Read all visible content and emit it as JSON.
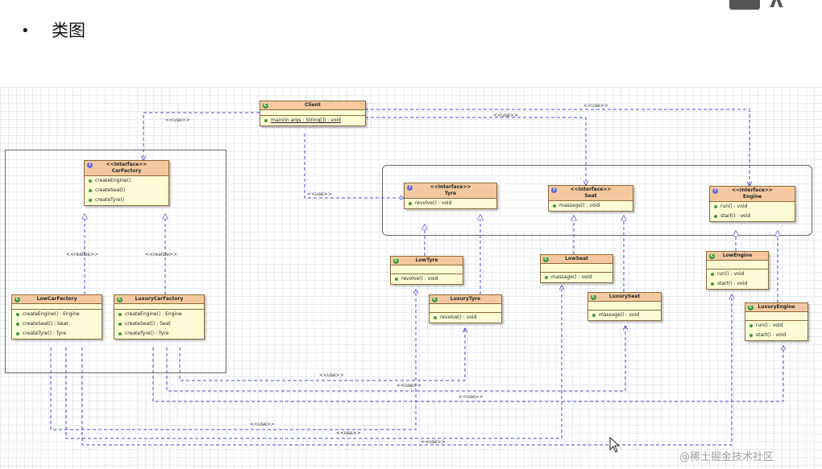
{
  "slide": {
    "bullet": "•",
    "heading": "类图"
  },
  "classes": {
    "client": {
      "name": "Client",
      "methods": [
        "main(in args : String[]) : void"
      ]
    },
    "car_factory": {
      "stereotype": "<<Interface>>",
      "name": "CarFactory",
      "methods": [
        "createEngine()",
        "createSeat()",
        "createTyre()"
      ]
    },
    "low_car_factory": {
      "name": "LowCarFactory",
      "methods": [
        "createEngine() : Engine",
        "createSeat() : Seat",
        "createTyre() : Tyre"
      ]
    },
    "luxury_car_factory": {
      "name": "LuxuryCarFactory",
      "methods": [
        "createEngine() : Engine",
        "createSeat() : Seat",
        "createTyre() : Tyre"
      ]
    },
    "tyre": {
      "stereotype": "<<Interface>>",
      "name": "Tyre",
      "methods": [
        "revolve() : void"
      ]
    },
    "seat": {
      "stereotype": "<<Interface>>",
      "name": "Seat",
      "methods": [
        "massage() : void"
      ]
    },
    "engine": {
      "stereotype": "<<Interface>>",
      "name": "Engine",
      "methods": [
        "run() : void",
        "start() : void"
      ]
    },
    "low_tyre": {
      "name": "LowTyre",
      "methods": [
        "revolve() : void"
      ]
    },
    "luxury_tyre": {
      "name": "LuxuryTyre",
      "methods": [
        "revolve() : void"
      ]
    },
    "low_seat": {
      "name": "LowSeat",
      "methods": [
        "massage() : void"
      ]
    },
    "luxury_seat": {
      "name": "LuxurySeat",
      "methods": [
        "massage() : void"
      ]
    },
    "low_engine": {
      "name": "LowEngine",
      "methods": [
        "run() : void",
        "start() : void"
      ]
    },
    "luxury_engine": {
      "name": "LuxuryEngine",
      "methods": [
        "run() : void",
        "start() : void"
      ]
    }
  },
  "labels": {
    "use": "<<use>>",
    "realize": "<<realize>>"
  },
  "watermark": "@稀土掘金技术社区",
  "colors": {
    "header": "#f4c9a0",
    "body": "#fdfbd6",
    "connector": "#4848c8"
  }
}
